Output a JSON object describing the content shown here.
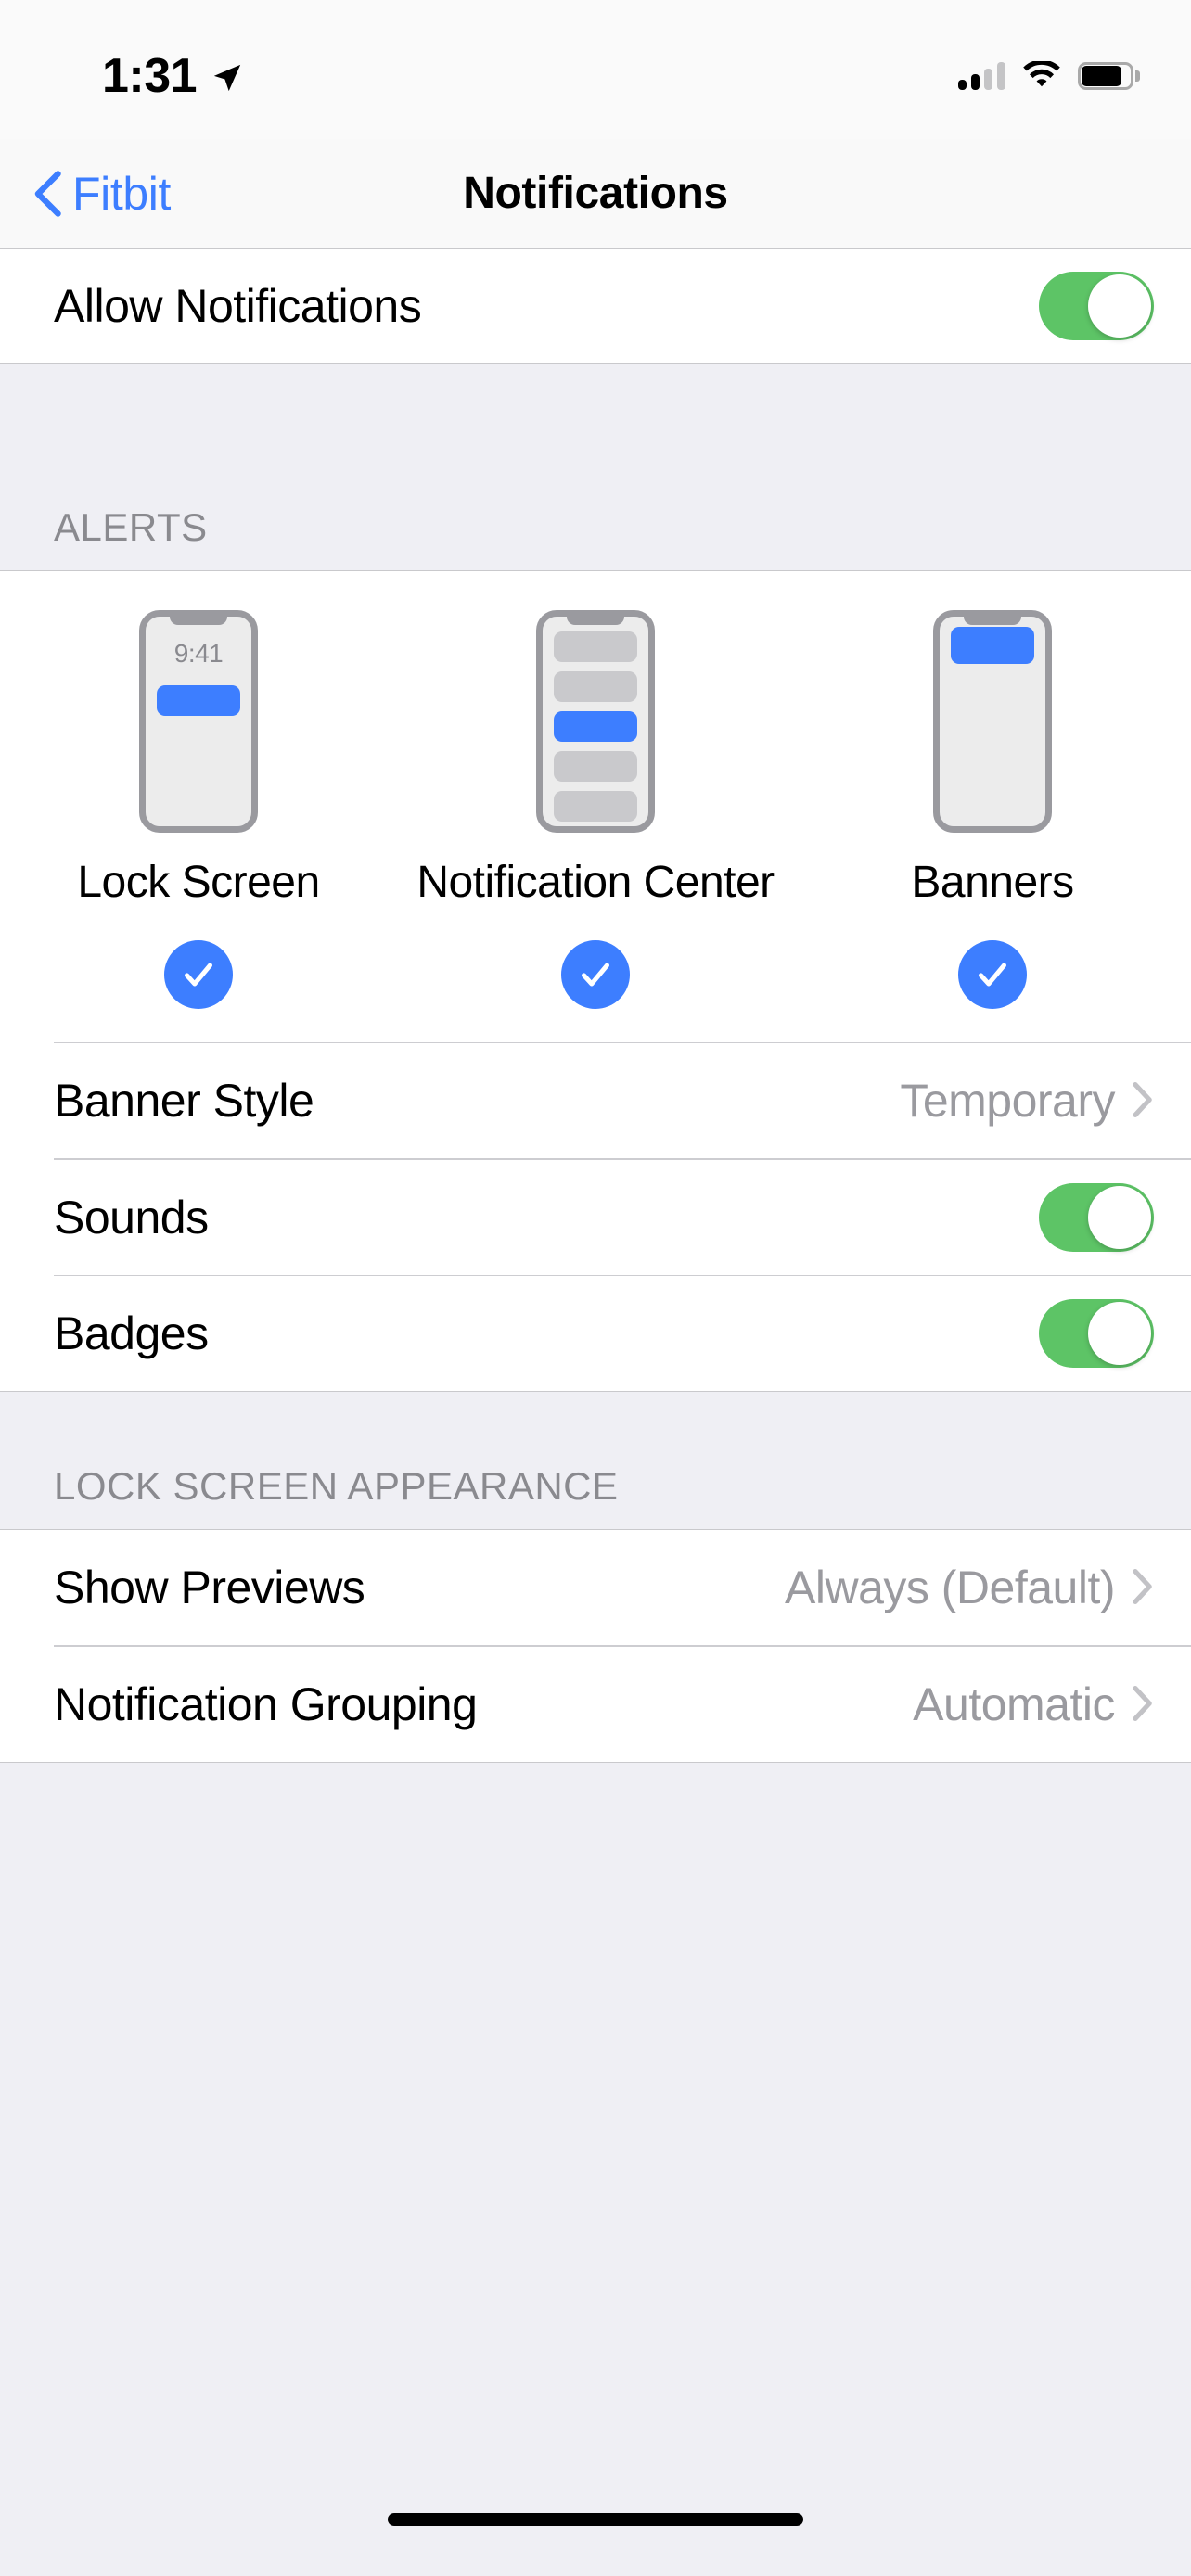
{
  "status_bar": {
    "time": "1:31",
    "location_icon": "location-arrow-icon",
    "cellular_icon": "cellular-signal-icon",
    "cellular_bars_filled": 2,
    "cellular_bars_total": 4,
    "wifi_icon": "wifi-icon",
    "battery_icon": "battery-icon",
    "battery_level_percent": 72
  },
  "nav_bar": {
    "back_label": "Fitbit",
    "back_icon": "chevron-left-icon",
    "title": "Notifications"
  },
  "allow_section": {
    "label": "Allow Notifications",
    "toggle_on": true
  },
  "alerts_section": {
    "header": "ALERTS",
    "options": [
      {
        "label": "Lock Screen",
        "checked": true,
        "preview": "lock-screen",
        "preview_time": "9:41"
      },
      {
        "label": "Notification Center",
        "checked": true,
        "preview": "notification-center"
      },
      {
        "label": "Banners",
        "checked": true,
        "preview": "banners"
      }
    ],
    "rows": [
      {
        "label": "Banner Style",
        "value": "Temporary",
        "type": "disclosure"
      },
      {
        "label": "Sounds",
        "toggle_on": true,
        "type": "toggle"
      },
      {
        "label": "Badges",
        "toggle_on": true,
        "type": "toggle"
      }
    ]
  },
  "lock_screen_appearance": {
    "header": "LOCK SCREEN APPEARANCE",
    "rows": [
      {
        "label": "Show Previews",
        "value": "Always (Default)",
        "type": "disclosure"
      },
      {
        "label": "Notification Grouping",
        "value": "Automatic",
        "type": "disclosure"
      }
    ]
  },
  "colors": {
    "accent_blue": "#3D7EFF",
    "toggle_green": "#5DC466",
    "group_background": "#EFEFF4",
    "row_background": "#FFFFFF",
    "secondary_text": "#8A8A8F",
    "value_text": "#9A9A9F"
  },
  "home_indicator": "home-indicator"
}
